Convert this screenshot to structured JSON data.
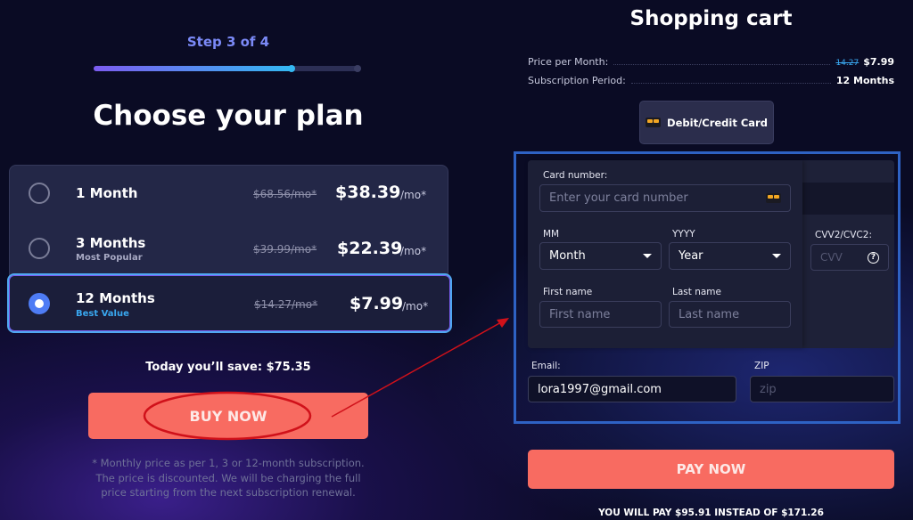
{
  "left": {
    "step": "Step 3 of 4",
    "progress_percent": 74,
    "title": "Choose your plan",
    "plans": [
      {
        "name": "1 Month",
        "subtitle": "",
        "old_price": "$68.56/mo*",
        "price": "$38.39",
        "unit": "/mo*",
        "selected": false
      },
      {
        "name": "3 Months",
        "subtitle": "Most Popular",
        "old_price": "$39.99/mo*",
        "price": "$22.39",
        "unit": "/mo*",
        "selected": false
      },
      {
        "name": "12 Months",
        "subtitle": "Best Value",
        "old_price": "$14.27/mo*",
        "price": "$7.99",
        "unit": "/mo*",
        "selected": true
      }
    ],
    "save": "Today you’ll save: $75.35",
    "buy_label": "BUY NOW",
    "footnote": "* Monthly price as per 1, 3 or 12-month subscription. The price is discounted. We will be charging the full price starting from the next subscription renewal."
  },
  "right": {
    "title": "Shopping cart",
    "price_label": "Price per Month:",
    "price_old": "14.27",
    "price_new": "$7.99",
    "period_label": "Subscription Period:",
    "period_value": "12 Months",
    "method": "Debit/Credit Card",
    "card_label": "Card number:",
    "card_placeholder": "Enter your card number",
    "mm_label": "MM",
    "mm_value": "Month",
    "yyyy_label": "YYYY",
    "yyyy_value": "Year",
    "cvv_label": "CVV2/CVC2:",
    "cvv_placeholder": "CVV",
    "cvv_help": "?",
    "first_label": "First name",
    "first_placeholder": "First name",
    "last_label": "Last name",
    "last_placeholder": "Last name",
    "email_label": "Email:",
    "email_value": "lora1997@gmail.com",
    "zip_label": "ZIP",
    "zip_placeholder": "zip",
    "pay_label": "PAY NOW",
    "total": "YOU WILL PAY $95.91 INSTEAD OF $171.26"
  },
  "colors": {
    "accent": "#f86b61",
    "highlight": "#2e62c4",
    "annotation": "#d0111a",
    "step": "#7b8af7"
  }
}
